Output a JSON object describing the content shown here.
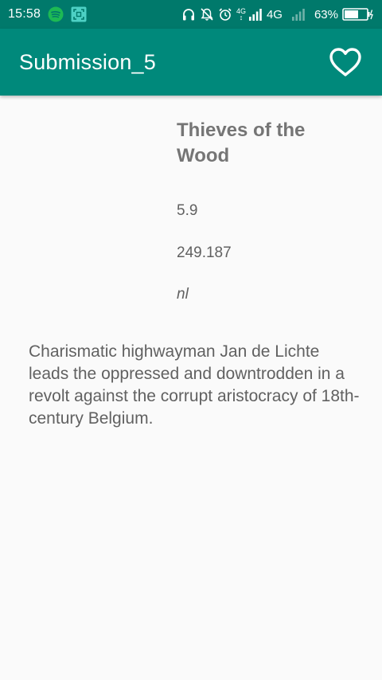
{
  "status_bar": {
    "time": "15:58",
    "network_label": "4G",
    "network_small_top": "4G",
    "network_small_bottom": "↕",
    "battery_percent": "63%"
  },
  "app_bar": {
    "title": "Submission_5"
  },
  "movie": {
    "title": "Thieves of the Wood",
    "rating": "5.9",
    "popularity": "249.187",
    "language": "nl",
    "overview": "Charismatic highwayman Jan de Lichte leads the oppressed and downtrodden in a revolt against the corrupt aristocracy of 18th-century Belgium."
  },
  "colors": {
    "status_bar": "#00796b",
    "app_bar": "#00897b",
    "spotify": "#1db954",
    "background": "#fafafa"
  },
  "icons": {
    "status_left": [
      "spotify-icon",
      "screenshot-icon"
    ],
    "status_right": [
      "headphones-icon",
      "notifications-off-icon",
      "alarm-icon",
      "signal-icon",
      "signal-weak-icon",
      "battery-icon"
    ],
    "app_bar": "heart-outline-icon"
  },
  "battery_level": 0.63
}
